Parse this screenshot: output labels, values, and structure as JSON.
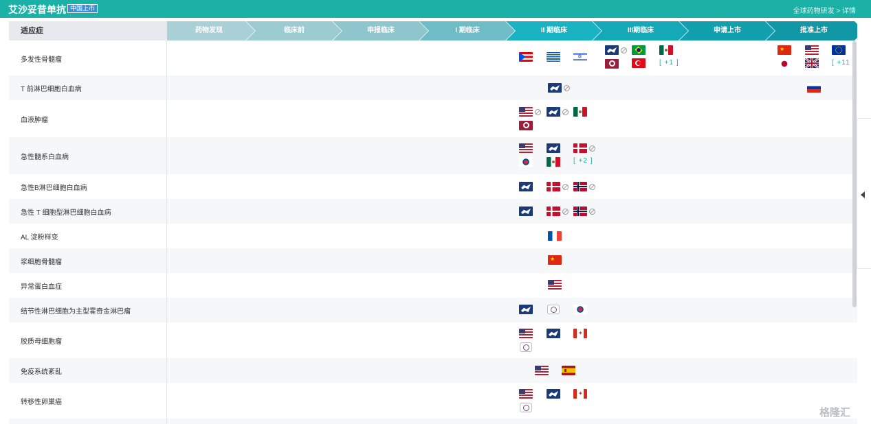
{
  "header": {
    "title": "艾沙妥昔单抗",
    "badge": "中国上市",
    "breadcrumb": "全球药物研发 > 详情"
  },
  "table_header": {
    "indication": "适应症"
  },
  "stages": [
    "药物发现",
    "临床前",
    "申报临床",
    "I 期临床",
    "II 期临床",
    "III期临床",
    "申请上市",
    "批准上市"
  ],
  "stage_colors": [
    "#a8d0d6",
    "#9dcbd2",
    "#8fc6cd",
    "#6fbcc6",
    "#19b3c3",
    "#15a9b7",
    "#12a0ae",
    "#1197a6"
  ],
  "rows": [
    {
      "label": "多发性骨髓瘤",
      "flags": [
        [
          "puerto-rico",
          "greece",
          "israel"
        ],
        [
          "eu-ema",
          "na",
          "brazil",
          "mexico",
          "taiwan",
          "turkey",
          "+1"
        ],
        [
          "china",
          "usa",
          "eu",
          "japan",
          "uk",
          "+11"
        ]
      ]
    },
    {
      "label": "T 前淋巴细胞白血病",
      "flags": [
        [
          "eu-ema",
          "na"
        ],
        [],
        [
          "russia"
        ]
      ]
    },
    {
      "label": "血液肿瘤",
      "flags": [
        [
          "usa",
          "na",
          "eu-ema",
          "na",
          "mexico",
          "taiwan"
        ]
      ]
    },
    {
      "label": "急性髓系白血病",
      "flags": [
        [
          "usa",
          "eu-ema",
          "denmark",
          "na",
          "korea",
          "mexico",
          "+2"
        ]
      ]
    },
    {
      "label": "急性B淋巴细胞白血病",
      "flags": [
        [
          "eu-ema",
          "denmark",
          "na",
          "norway",
          "na"
        ]
      ]
    },
    {
      "label": "急性 T 细胞型淋巴细胞白血病",
      "flags": [
        [
          "eu-ema",
          "denmark",
          "na",
          "norway",
          "na"
        ]
      ]
    },
    {
      "label": "AL 淀粉样变",
      "flags": [
        [
          "france"
        ]
      ]
    },
    {
      "label": "浆细胞骨髓瘤",
      "flags": [
        [
          "china"
        ]
      ]
    },
    {
      "label": "异常蛋白血症",
      "flags": [
        [
          "usa"
        ]
      ]
    },
    {
      "label": "结节性淋巴细胞为主型霍奇金淋巴瘤",
      "flags": [
        [
          "eu-ema",
          "taiwan-seal",
          "korea"
        ]
      ]
    },
    {
      "label": "胶质母细胞瘤",
      "flags": [
        [
          "usa",
          "eu-ema",
          "canada",
          "taiwan-seal"
        ]
      ]
    },
    {
      "label": "免疫系统紊乱",
      "flags": [
        [
          "usa",
          "spain"
        ]
      ]
    },
    {
      "label": "转移性卵巢癌",
      "flags": [
        [
          "usa",
          "eu-ema",
          "canada",
          "taiwan-seal"
        ]
      ]
    }
  ],
  "more_counts": {
    "mm_phase3": "[ +1 ]",
    "mm_approved": "[ +11 ]",
    "aml": "[ +2 ]"
  },
  "watermark": "格隆汇"
}
